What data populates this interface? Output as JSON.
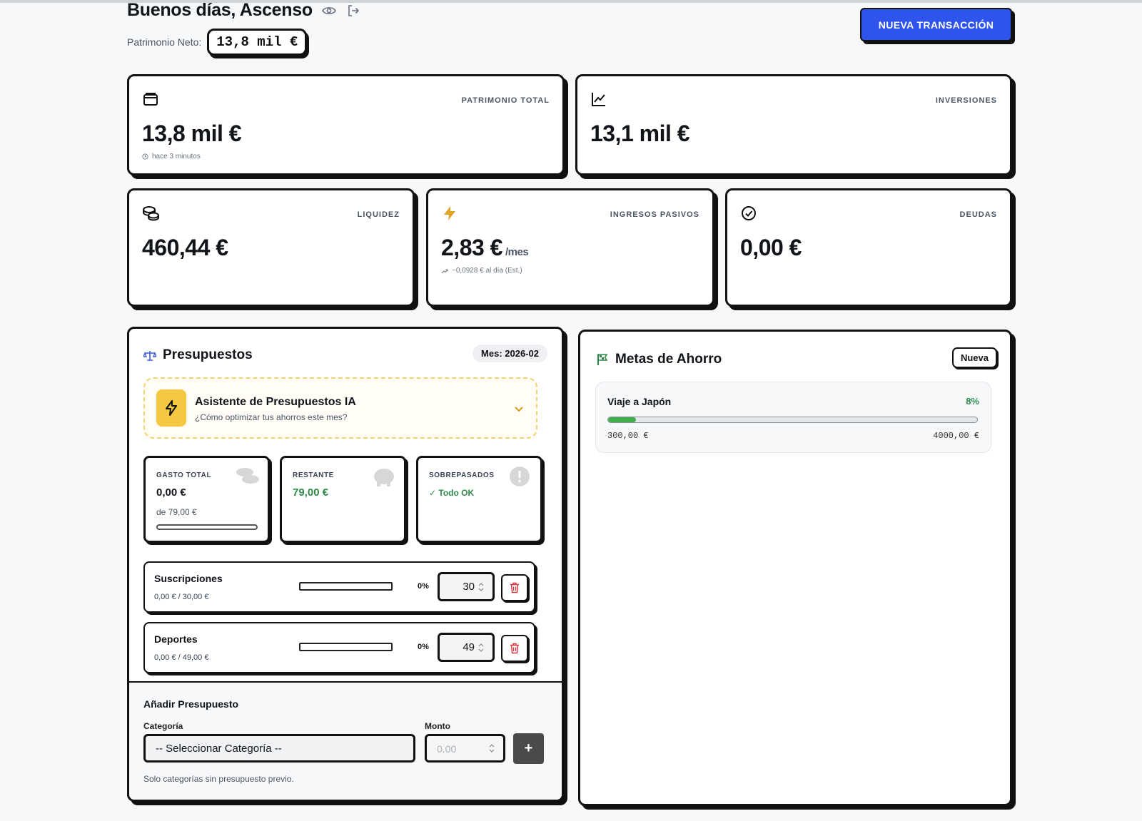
{
  "header": {
    "greeting": "Buenos días, Ascenso",
    "networth_label": "Patrimonio Neto:",
    "networth_value": "13,8 mil €",
    "new_transaction_label": "NUEVA TRANSACCIÓN",
    "accent_color": "#2f54eb"
  },
  "stats": {
    "patrimonio": {
      "label": "PATRIMONIO TOTAL",
      "value": "13,8 mil €",
      "sub": "hace 3 minutos",
      "icon": "wallet-icon"
    },
    "inversiones": {
      "label": "INVERSIONES",
      "value": "13,1 mil €",
      "icon": "chart-line-icon"
    },
    "liquidez": {
      "label": "LIQUIDEZ",
      "value": "460,44 €",
      "icon": "coins-icon"
    },
    "ingresos": {
      "label": "INGRESOS PASIVOS",
      "value": "2,83 €",
      "unit": "/mes",
      "sub": "~0,0928 € al día (Est.)",
      "icon": "lightning-icon"
    },
    "deudas": {
      "label": "DEUDAS",
      "value": "0,00 €",
      "icon": "check-circle-icon"
    }
  },
  "budgets": {
    "title": "Presupuestos",
    "month": "Mes: 2026-02",
    "ai": {
      "title": "Asistente de Presupuestos IA",
      "subtitle": "¿Cómo optimizar tus ahorros este mes?"
    },
    "summary": {
      "gasto_label": "GASTO TOTAL",
      "gasto_value": "0,00 €",
      "gasto_sub": "de 79,00 €",
      "gasto_progress": 0,
      "restante_label": "RESTANTE",
      "restante_value": "79,00 €",
      "sobre_label": "SOBREPASADOS",
      "sobre_value": "✓ Todo OK"
    },
    "items": [
      {
        "name": "Suscripciones",
        "amount": "0,00 € / 30,00 €",
        "pct": "0%",
        "progress": 0,
        "limit": "30"
      },
      {
        "name": "Deportes",
        "amount": "0,00 € / 49,00 €",
        "pct": "0%",
        "progress": 0,
        "limit": "49"
      }
    ],
    "add": {
      "title": "Añadir Presupuesto",
      "category_label": "Categoría",
      "category_value": "-- Seleccionar Categoría --",
      "amount_label": "Monto",
      "amount_placeholder": "0.00",
      "add_button": "+",
      "help": "Solo categorías sin presupuesto previo."
    }
  },
  "goals": {
    "title": "Metas de Ahorro",
    "new_button": "Nueva",
    "items": [
      {
        "name": "Viaje a Japón",
        "pct": "8%",
        "progress": 0.075,
        "current": "300,00 €",
        "target": "4000,00 €"
      }
    ]
  }
}
